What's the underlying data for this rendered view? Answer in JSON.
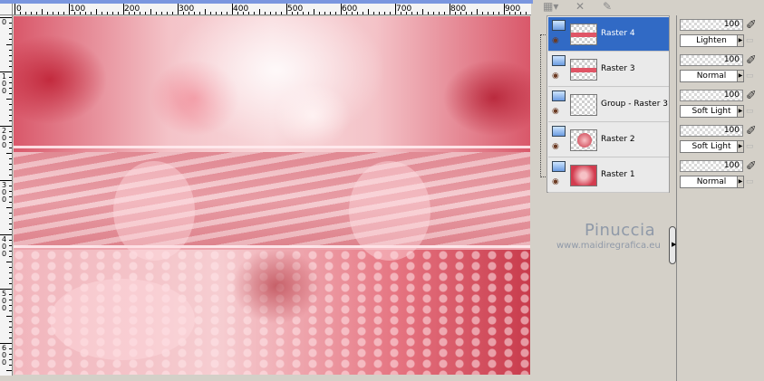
{
  "ruler": {
    "top_labels": [
      "0",
      "100",
      "200",
      "300",
      "400",
      "500",
      "600",
      "700",
      "800",
      "900"
    ],
    "left_labels": [
      "0",
      "1 0 0",
      "2 0 0",
      "3 0 0",
      "4 0 0",
      "5 0 0",
      "6 0 0"
    ]
  },
  "layers": [
    {
      "name": "Raster 4",
      "selected": true,
      "thumb": "band",
      "opacity": "100",
      "blend": "Lighten"
    },
    {
      "name": "Raster 3",
      "selected": false,
      "thumb": "band",
      "opacity": "100",
      "blend": "Normal"
    },
    {
      "name": "Group - Raster 3",
      "selected": false,
      "thumb": "empty",
      "opacity": "100",
      "blend": "Soft Light"
    },
    {
      "name": "Raster 2",
      "selected": false,
      "thumb": "flower",
      "opacity": "100",
      "blend": "Soft Light"
    },
    {
      "name": "Raster 1",
      "selected": false,
      "thumb": "full",
      "opacity": "100",
      "blend": "Normal"
    }
  ],
  "watermark": {
    "name": "Pinuccia",
    "url": "www.maidiregrafica.eu"
  },
  "icons": {
    "visibility": "eye-icon",
    "layer_type": "raster-layer-icon",
    "paint": "paintbrush-icon",
    "lock": "lock-icon"
  },
  "colors": {
    "selection": "#316ac5",
    "canvas_pink": "#f0b8be",
    "canvas_red": "#c83b4c"
  }
}
